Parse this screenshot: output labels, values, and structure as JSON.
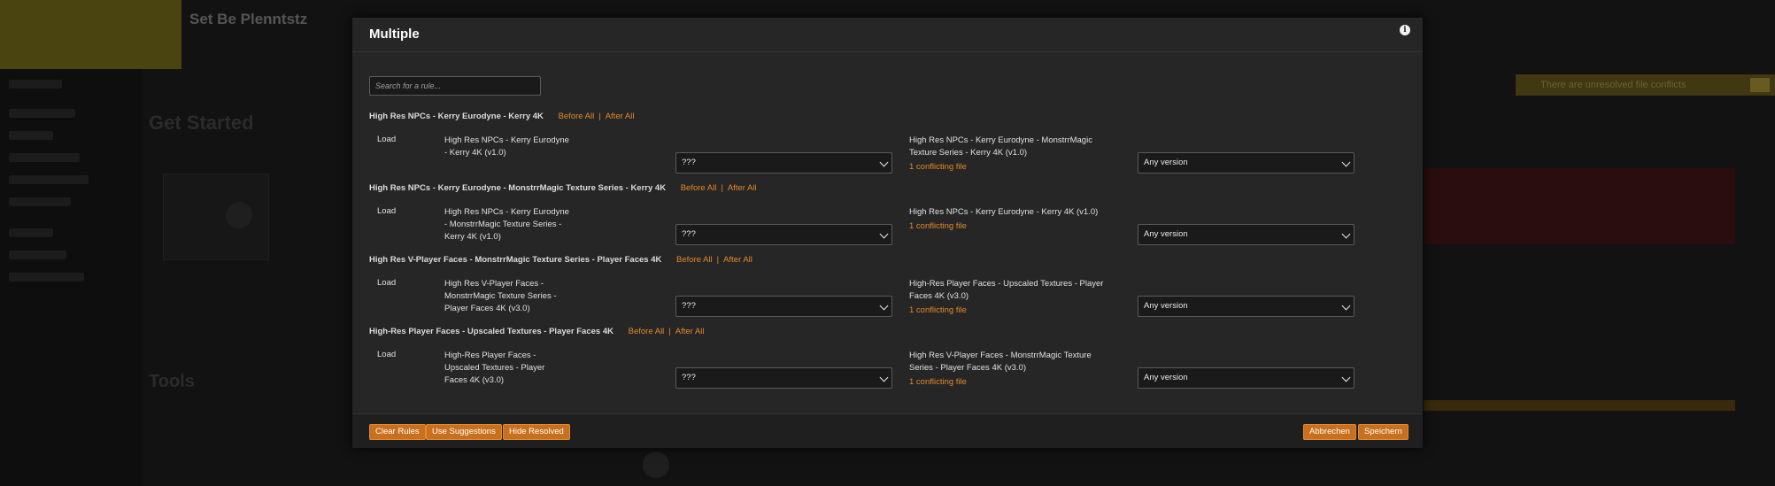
{
  "background": {
    "banner_title": "Set Be Plenntstz",
    "heading": "Get Started",
    "tools_heading": "Tools",
    "warning_text": "There are unresolved file conflicts"
  },
  "modal": {
    "title": "Multiple",
    "info_icon": "info-icon",
    "search_placeholder": "Search for a rule...",
    "link_before": "Before All",
    "link_after": "After All",
    "link_sep": "|",
    "rules": [
      {
        "header": "High Res NPCs - Kerry Eurodyne - Kerry 4K",
        "action": "Load",
        "mod_lines": [
          "High Res NPCs - Kerry Eurodyne",
          "- Kerry 4K (v1.0)"
        ],
        "select_value": "???",
        "conflict_lines": [
          "High Res NPCs - Kerry Eurodyne - MonstrrMagic",
          "Texture Series - Kerry 4K (v1.0)"
        ],
        "conflict_link": "1 conflicting file",
        "version_value": "Any version"
      },
      {
        "header": "High Res NPCs - Kerry Eurodyne - MonstrrMagic Texture Series - Kerry 4K",
        "action": "Load",
        "mod_lines": [
          "High Res NPCs - Kerry Eurodyne",
          "- MonstrrMagic Texture Series -",
          "Kerry 4K (v1.0)"
        ],
        "select_value": "???",
        "conflict_lines": [
          "High Res NPCs - Kerry Eurodyne - Kerry 4K (v1.0)"
        ],
        "conflict_link": "1 conflicting file",
        "version_value": "Any version"
      },
      {
        "header": "High Res V-Player Faces - MonstrrMagic Texture Series - Player Faces 4K",
        "action": "Load",
        "mod_lines": [
          "High Res V-Player Faces -",
          "MonstrrMagic Texture Series -",
          "Player Faces 4K (v3.0)"
        ],
        "select_value": "???",
        "conflict_lines": [
          "High-Res Player Faces - Upscaled Textures - Player",
          "Faces 4K (v3.0)"
        ],
        "conflict_link": "1 conflicting file",
        "version_value": "Any version"
      },
      {
        "header": "High-Res Player Faces - Upscaled Textures - Player Faces 4K",
        "action": "Load",
        "mod_lines": [
          "High-Res Player Faces -",
          "Upscaled Textures - Player",
          "Faces 4K (v3.0)"
        ],
        "select_value": "???",
        "conflict_lines": [
          "High Res V-Player Faces - MonstrrMagic Texture",
          "Series - Player Faces 4K (v3.0)"
        ],
        "conflict_link": "1 conflicting file",
        "version_value": "Any version"
      }
    ],
    "footer": {
      "clear_rules": "Clear Rules",
      "use_suggestions": "Use Suggestions",
      "hide_resolved": "Hide Resolved",
      "cancel": "Abbrechen",
      "save": "Speichern"
    }
  }
}
